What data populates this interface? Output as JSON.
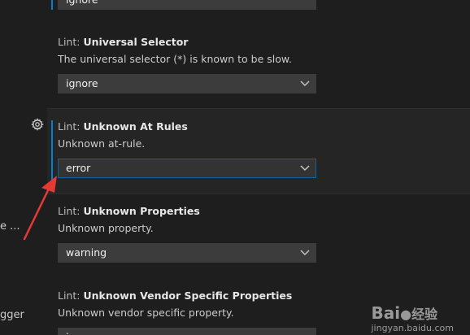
{
  "top_cut": {
    "value": "ignore"
  },
  "left_stubs": {
    "line1": "e ...",
    "line2": "gger"
  },
  "settings": [
    {
      "category": "Lint: ",
      "name": "Universal Selector",
      "description": "The universal selector (*) is known to be slow.",
      "value": "ignore"
    },
    {
      "category": "Lint: ",
      "name": "Unknown At Rules",
      "description": "Unknown at-rule.",
      "value": "error"
    },
    {
      "category": "Lint: ",
      "name": "Unknown Properties",
      "description": "Unknown property.",
      "value": "warning"
    },
    {
      "category": "Lint: ",
      "name": "Unknown Vendor Specific Properties",
      "description": "Unknown vendor specific property.",
      "value": "ig"
    }
  ],
  "watermark": {
    "brand": "Bai",
    "brand2": "经验",
    "url": "jingyan.baidu.com"
  },
  "colors": {
    "accent": "#007fd4",
    "annotation_arrow": "#e53935",
    "background": "#1e1e1e"
  },
  "icons": {
    "gear": "gear-icon",
    "dropdown": "chevron-down-icon"
  }
}
